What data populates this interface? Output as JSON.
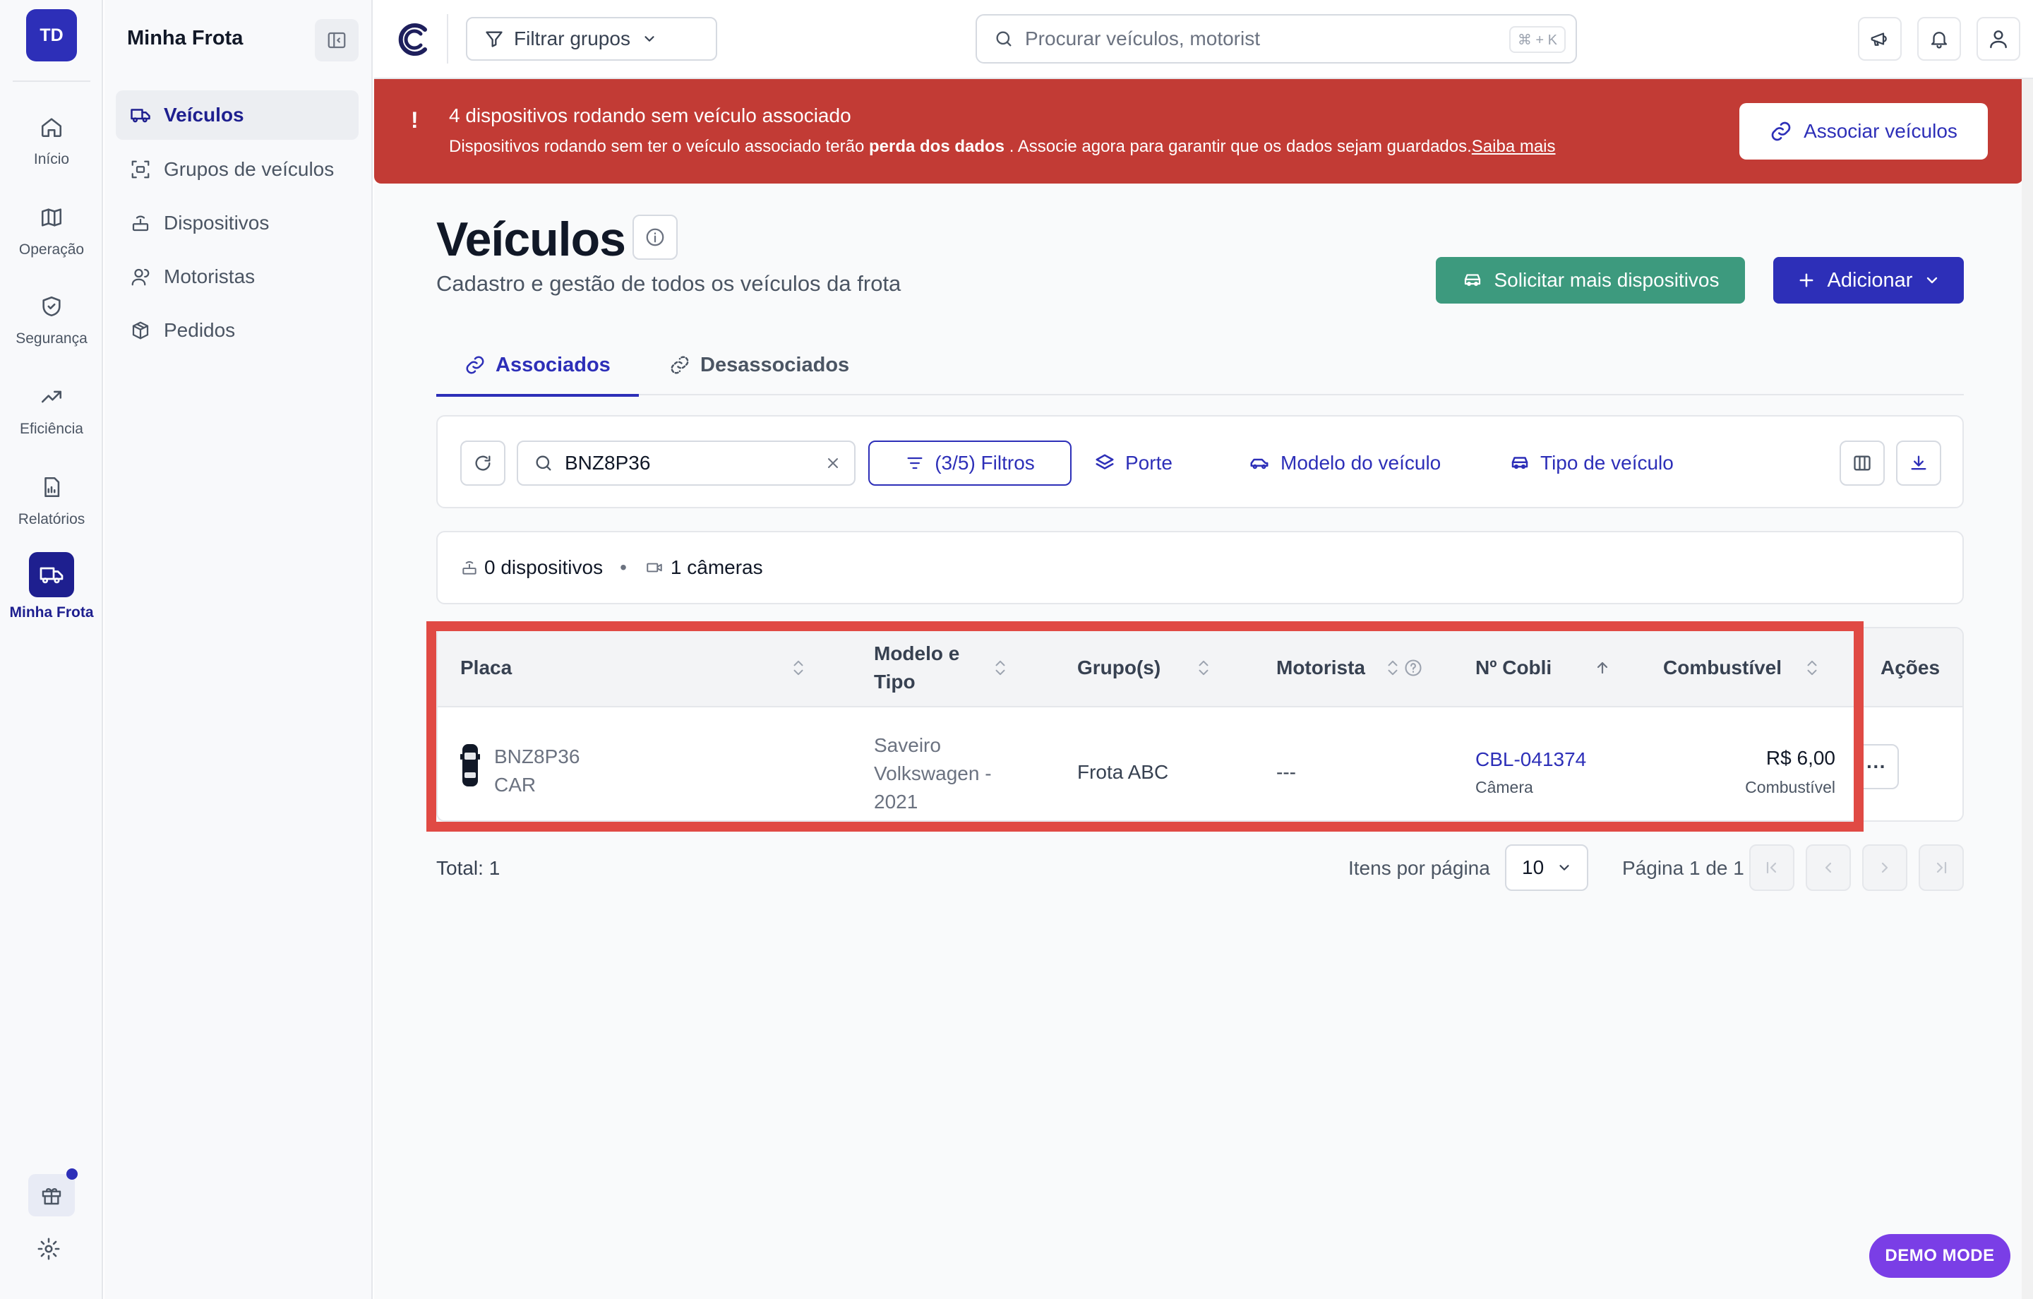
{
  "user": {
    "initials": "TD"
  },
  "rail": {
    "items": [
      {
        "label": "Início",
        "icon": "home-icon"
      },
      {
        "label": "Operação",
        "icon": "map-icon"
      },
      {
        "label": "Segurança",
        "icon": "shield-icon"
      },
      {
        "label": "Eficiência",
        "icon": "trending-up-icon"
      },
      {
        "label": "Relatórios",
        "icon": "report-icon"
      },
      {
        "label": "Minha Frota",
        "icon": "truck-icon",
        "active": true
      }
    ]
  },
  "sidebar": {
    "title": "Minha Frota",
    "items": [
      {
        "label": "Veículos",
        "icon": "truck-icon",
        "active": true
      },
      {
        "label": "Grupos de veículos",
        "icon": "vehicle-group-icon"
      },
      {
        "label": "Dispositivos",
        "icon": "device-icon"
      },
      {
        "label": "Motoristas",
        "icon": "users-icon"
      },
      {
        "label": "Pedidos",
        "icon": "package-icon"
      }
    ]
  },
  "topbar": {
    "filter_groups_label": "Filtrar grupos",
    "search_placeholder": "Procurar veículos, motorist",
    "shortcut": "⌘ + K"
  },
  "alert": {
    "title": "4 dispositivos rodando sem veículo associado",
    "desc_pre": "Dispositivos rodando sem ter o veículo associado terão ",
    "desc_bold": "perda dos dados",
    "desc_post": " . Associe agora para garantir que os dados sejam guardados.",
    "desc_link": "Saiba mais",
    "button": "Associar veículos",
    "color": "#c23b35"
  },
  "page": {
    "title": "Veículos",
    "subtitle": "Cadastro e gestão de todos os veículos da frota",
    "request_button": "Solicitar mais dispositivos",
    "add_button": "Adicionar"
  },
  "tabs": [
    {
      "label": "Associados",
      "active": true
    },
    {
      "label": "Desassociados"
    }
  ],
  "toolbar": {
    "search_value": "BNZ8P36",
    "filters_label": "(3/5) Filtros",
    "chips": [
      "Porte",
      "Modelo do veículo",
      "Tipo de veículo"
    ]
  },
  "summary": {
    "devices": "0 dispositivos",
    "cameras": "1 câmeras"
  },
  "table": {
    "columns": [
      "Placa",
      "Modelo e Tipo",
      "Grupo(s)",
      "Motorista",
      "Nº Cobli",
      "Combustível",
      "Ações"
    ],
    "rows": [
      {
        "plate": "BNZ8P36",
        "type": "CAR",
        "model_line1": "Saveiro",
        "model_line2": "Volkswagen -",
        "model_line3": "2021",
        "group": "Frota ABC",
        "driver": "---",
        "cobli_id": "CBL-041374",
        "cobli_sub": "Câmera",
        "fuel_value": "R$ 6,00",
        "fuel_sub": "Combustível",
        "actions": "···"
      }
    ]
  },
  "pagination": {
    "total": "Total: 1",
    "per_page_label": "Itens por página",
    "per_page_value": "10",
    "page_info": "Página 1 de 1"
  },
  "demo_badge": "DEMO MODE",
  "colors": {
    "primary": "#2d2fb8",
    "success": "#3d9a7e",
    "highlight": "#e04a44",
    "demo": "#7a3ee6"
  }
}
